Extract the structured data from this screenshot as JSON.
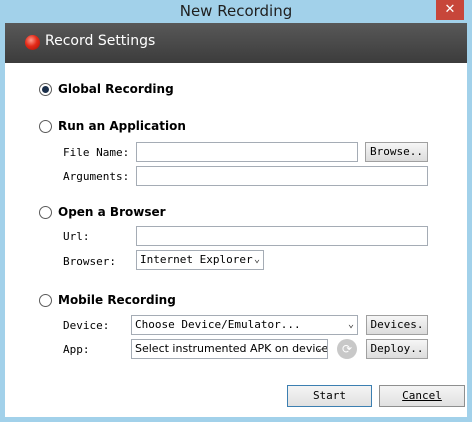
{
  "window": {
    "title": "New Recording",
    "close_glyph": "✕"
  },
  "header": {
    "title": "Record Settings",
    "icon": "record-icon"
  },
  "options": {
    "global": {
      "label": "Global Recording",
      "selected": true
    },
    "application": {
      "label": "Run an Application",
      "file_name_label": "File Name:",
      "file_name_value": "",
      "browse_label": "Browse..",
      "arguments_label": "Arguments:",
      "arguments_value": ""
    },
    "browser": {
      "label": "Open a Browser",
      "url_label": "Url:",
      "url_value": "",
      "browser_label": "Browser:",
      "browser_value": "Internet Explorer"
    },
    "mobile": {
      "label": "Mobile Recording",
      "device_label": "Device:",
      "device_value": "Choose Device/Emulator...",
      "devices_button": "Devices.",
      "app_label": "App:",
      "app_value": "Select instrumented APK on device...",
      "deploy_button": "Deploy.."
    }
  },
  "footer": {
    "start_label": "Start",
    "cancel_label": "Cancel"
  }
}
